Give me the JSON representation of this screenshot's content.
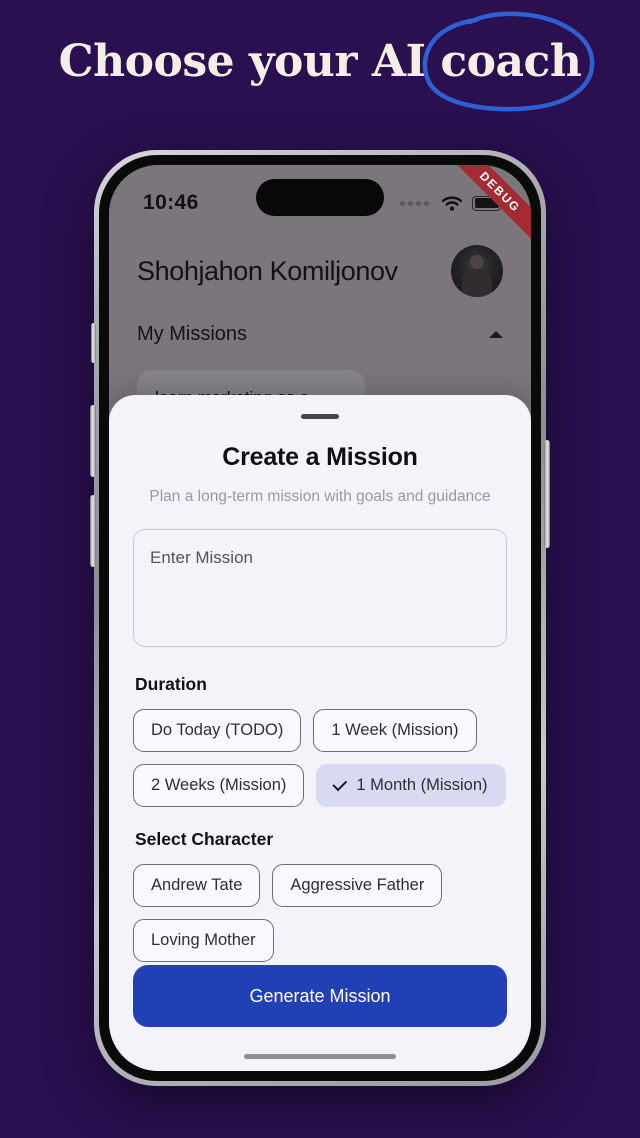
{
  "poster": {
    "headline": "Choose your AI coach",
    "background_color": "#2a1050",
    "headline_color": "#f3efe6",
    "annotation_color": "#2f5fd0",
    "annotation_target": "coach"
  },
  "status_bar": {
    "time": "10:46",
    "signal_icon": "signal-dots-icon",
    "wifi_icon": "wifi-icon",
    "battery_icon": "battery-full-icon",
    "debug_badge": "DEBUG",
    "debug_color": "#a32b33"
  },
  "app": {
    "user_name": "Shohjahon Komiljonov",
    "avatar_icon": "user-avatar",
    "section_title": "My Missions",
    "collapse_icon": "chevron-up-icon",
    "missions": [
      {
        "title": "learn marketing as a developer"
      }
    ]
  },
  "sheet": {
    "grabber_icon": "drag-handle-icon",
    "title": "Create a Mission",
    "subtitle": "Plan a long-term mission with goals and guidance",
    "mission_input": {
      "placeholder": "Enter Mission",
      "value": ""
    },
    "duration": {
      "label": "Duration",
      "options": [
        {
          "label": "Do Today (TODO)",
          "selected": false
        },
        {
          "label": "1 Week (Mission)",
          "selected": false
        },
        {
          "label": "2 Weeks (Mission)",
          "selected": false
        },
        {
          "label": "1 Month (Mission)",
          "selected": true
        }
      ],
      "selected_value": "1 Month (Mission)",
      "selected_color": "#d9d9f2"
    },
    "character": {
      "label": "Select Character",
      "options": [
        {
          "label": "Andrew Tate",
          "selected": false
        },
        {
          "label": "Aggressive Father",
          "selected": false
        },
        {
          "label": "Loving Mother",
          "selected": false
        }
      ],
      "selected_value": ""
    },
    "cta": {
      "label": "Generate Mission",
      "color": "#2240b5"
    }
  }
}
